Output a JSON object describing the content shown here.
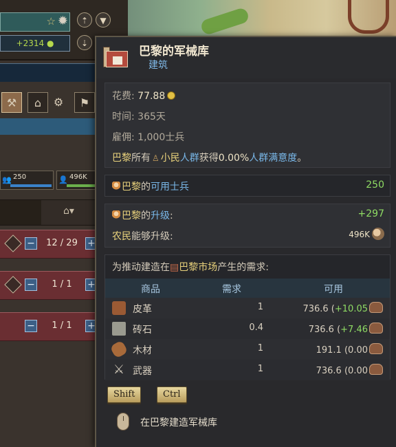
{
  "hud": {
    "income": "+2314",
    "pop_left_value": "250",
    "pop_right_value": "496K"
  },
  "rows": [
    {
      "count": "12 / 29",
      "minus": "−",
      "plus": "+"
    },
    {
      "count": "1 / 1",
      "minus": "−",
      "plus": "+"
    },
    {
      "count": "1 / 1",
      "minus": "−",
      "plus": "+"
    }
  ],
  "tooltip": {
    "title": "巴黎的军械库",
    "subtitle": "建筑",
    "cost_label": "花费:",
    "cost_value": "77.88",
    "time_label": "时间:",
    "time_value": "365天",
    "hire_label": "雇佣:",
    "hire_value": "1,000士兵",
    "effect": {
      "part1": "巴黎",
      "part2": "所有",
      "part3": "小民",
      "part4": "人群",
      "part5": "获得",
      "part6": "0.00%",
      "part7": "人群满意度",
      "part8": "。"
    },
    "soldiers_label_a": "巴黎",
    "soldiers_label_b": "的",
    "soldiers_label_c": "可用士兵",
    "soldiers_value": "250",
    "upgrade_label_a": "巴黎",
    "upgrade_label_b": "的",
    "upgrade_label_c": "升级",
    "upgrade_label_d": ":",
    "upgrade_value": "+297",
    "peasant_label_a": "农民",
    "peasant_label_b": "能够升级:",
    "peasant_value": "496K",
    "demand_intro_a": "为推动建造在",
    "demand_intro_b": "巴黎市场",
    "demand_intro_c": "产生的需求:",
    "columns": {
      "goods": "商品",
      "demand": "需求",
      "available": "可用"
    },
    "goods": [
      {
        "name": "皮革",
        "demand": "1",
        "avail": "736.6",
        "change": "+10.05",
        "icon": "leather-icon"
      },
      {
        "name": "砖石",
        "demand": "0.4",
        "avail": "736.6",
        "change": "+7.46",
        "icon": "bricks-icon"
      },
      {
        "name": "木材",
        "demand": "1",
        "avail": "191.1",
        "change": "0.00",
        "icon": "wood-icon"
      },
      {
        "name": "武器",
        "demand": "1",
        "avail": "736.6",
        "change": "0.00",
        "icon": "weapons-icon"
      }
    ],
    "key_shift": "Shift",
    "key_ctrl": "Ctrl",
    "hint": "在巴黎建造军械库"
  },
  "colors": {
    "accent_blue": "#79b7e8",
    "positive_green": "#8fdc64",
    "highlight_yellow": "#e9d27c"
  }
}
